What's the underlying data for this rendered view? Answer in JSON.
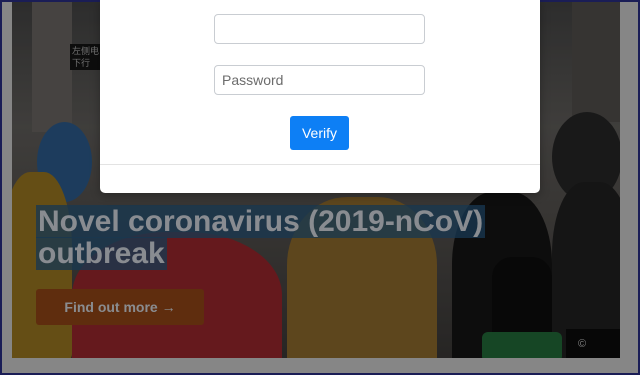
{
  "hero": {
    "headline": "Novel coronavirus (2019-nCoV) outbreak",
    "cta_label": "Find out more →",
    "credit": "©",
    "sign_text": "左侧电\n下行"
  },
  "login_modal": {
    "username": {
      "value": "",
      "placeholder": ""
    },
    "password": {
      "value": "",
      "placeholder": "Password"
    },
    "verify_label": "Verify"
  },
  "colors": {
    "window_border": "#2a2f8c",
    "accent": "#0d7ff5",
    "cta_background": "#9a4a17",
    "headline_highlight": "#285a82"
  }
}
